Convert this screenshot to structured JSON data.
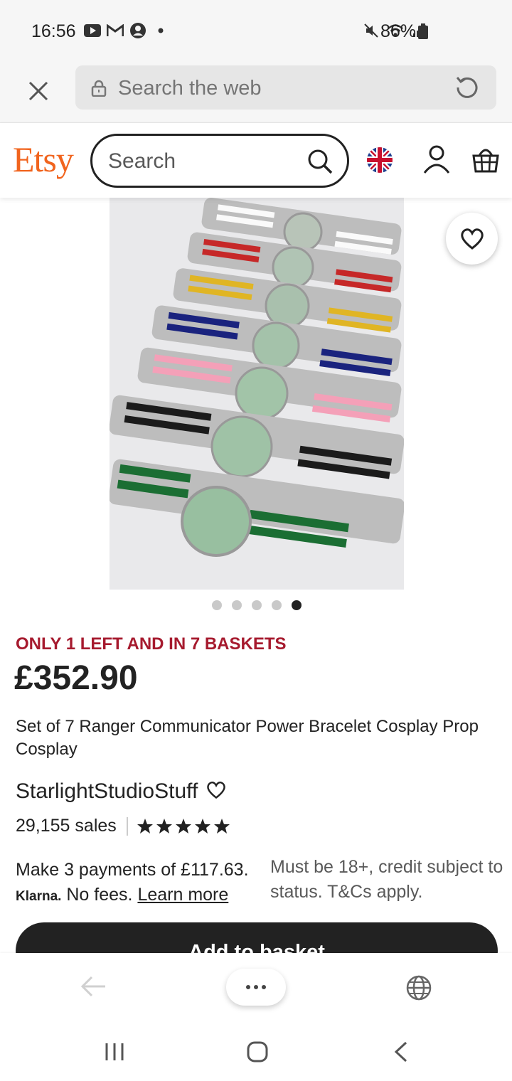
{
  "status_bar": {
    "time": "16:56",
    "battery": "86%",
    "left_icons": [
      "youtube-icon",
      "gmail-icon",
      "account-circle-icon",
      "dot-icon"
    ],
    "right_icons": [
      "mute-icon",
      "wifi-icon",
      "signal-icon",
      "battery-icon"
    ]
  },
  "browser": {
    "search_placeholder": "Search the web"
  },
  "etsy": {
    "logo": "Etsy",
    "search_placeholder": "Search",
    "brand_color": "#f1641e"
  },
  "product": {
    "image_dots_total": 5,
    "image_dots_active": 5,
    "stock_message": "ONLY 1 LEFT AND IN 7 BASKETS",
    "price": "£352.90",
    "title": "Set of 7 Ranger Communicator Power Bracelet Cosplay Prop Cosplay",
    "shop_name": "StarlightStudioStuff",
    "sales": "29,155 sales",
    "rating_stars": 5,
    "payment_line": "Make 3 payments of £117.63.",
    "klarna_label": "Klarna.",
    "no_fees": "No fees.",
    "learn_more": "Learn more",
    "credit_note": "Must be 18+, credit subject to status. T&Cs apply.",
    "add_to_basket": "Add to basket",
    "accent_color": "#a61a2e"
  }
}
